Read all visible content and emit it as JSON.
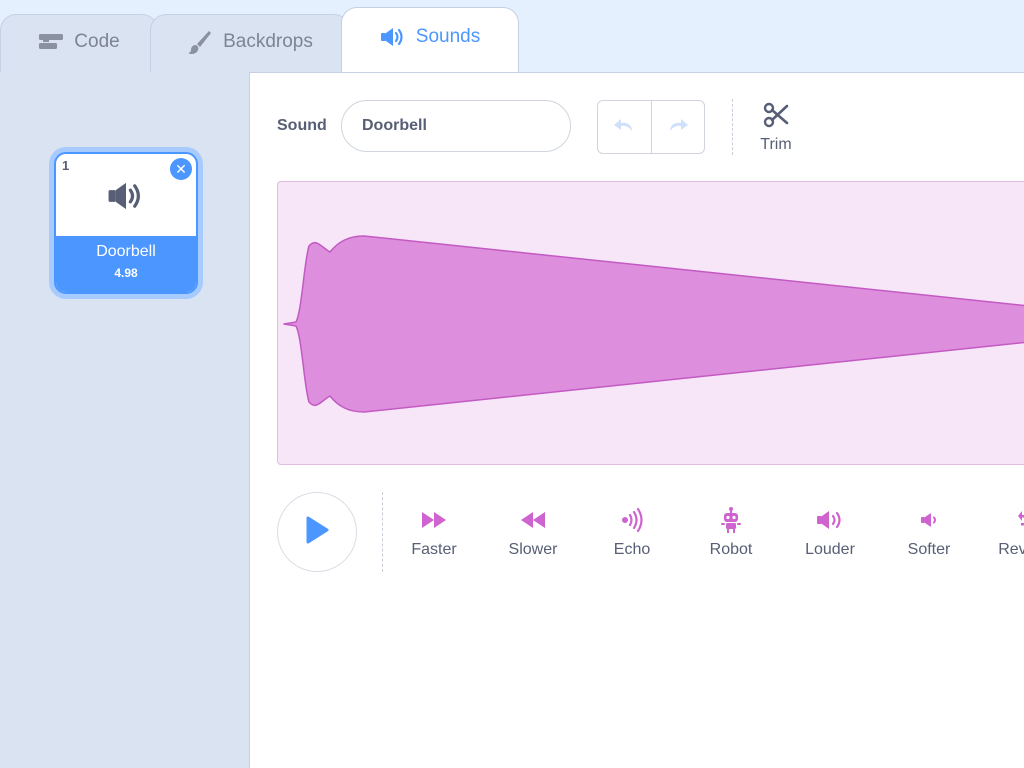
{
  "tabs": [
    {
      "label": "Code",
      "icon": "code-icon"
    },
    {
      "label": "Backdrops",
      "icon": "paintbrush-icon"
    },
    {
      "label": "Sounds",
      "icon": "speaker-icon",
      "active": true
    }
  ],
  "sound_list": {
    "items": [
      {
        "index": "1",
        "name": "Doorbell",
        "duration": "4.98",
        "icon": "speaker-icon",
        "selected": true
      }
    ]
  },
  "editor": {
    "sound_label": "Sound",
    "sound_name": "Doorbell",
    "trim_label": "Trim",
    "effects": [
      {
        "label": "Faster",
        "icon": "faster-icon"
      },
      {
        "label": "Slower",
        "icon": "slower-icon"
      },
      {
        "label": "Echo",
        "icon": "echo-icon"
      },
      {
        "label": "Robot",
        "icon": "robot-icon"
      },
      {
        "label": "Louder",
        "icon": "louder-icon"
      },
      {
        "label": "Softer",
        "icon": "softer-icon"
      },
      {
        "label": "Reverse",
        "icon": "reverse-icon"
      }
    ]
  },
  "colors": {
    "accent": "#4c97ff",
    "waveform_fill": "#dd8edd",
    "waveform_stroke": "#c35ac3",
    "waveform_background": "#f7e6f7",
    "effect_icon": "#cf63cf"
  }
}
